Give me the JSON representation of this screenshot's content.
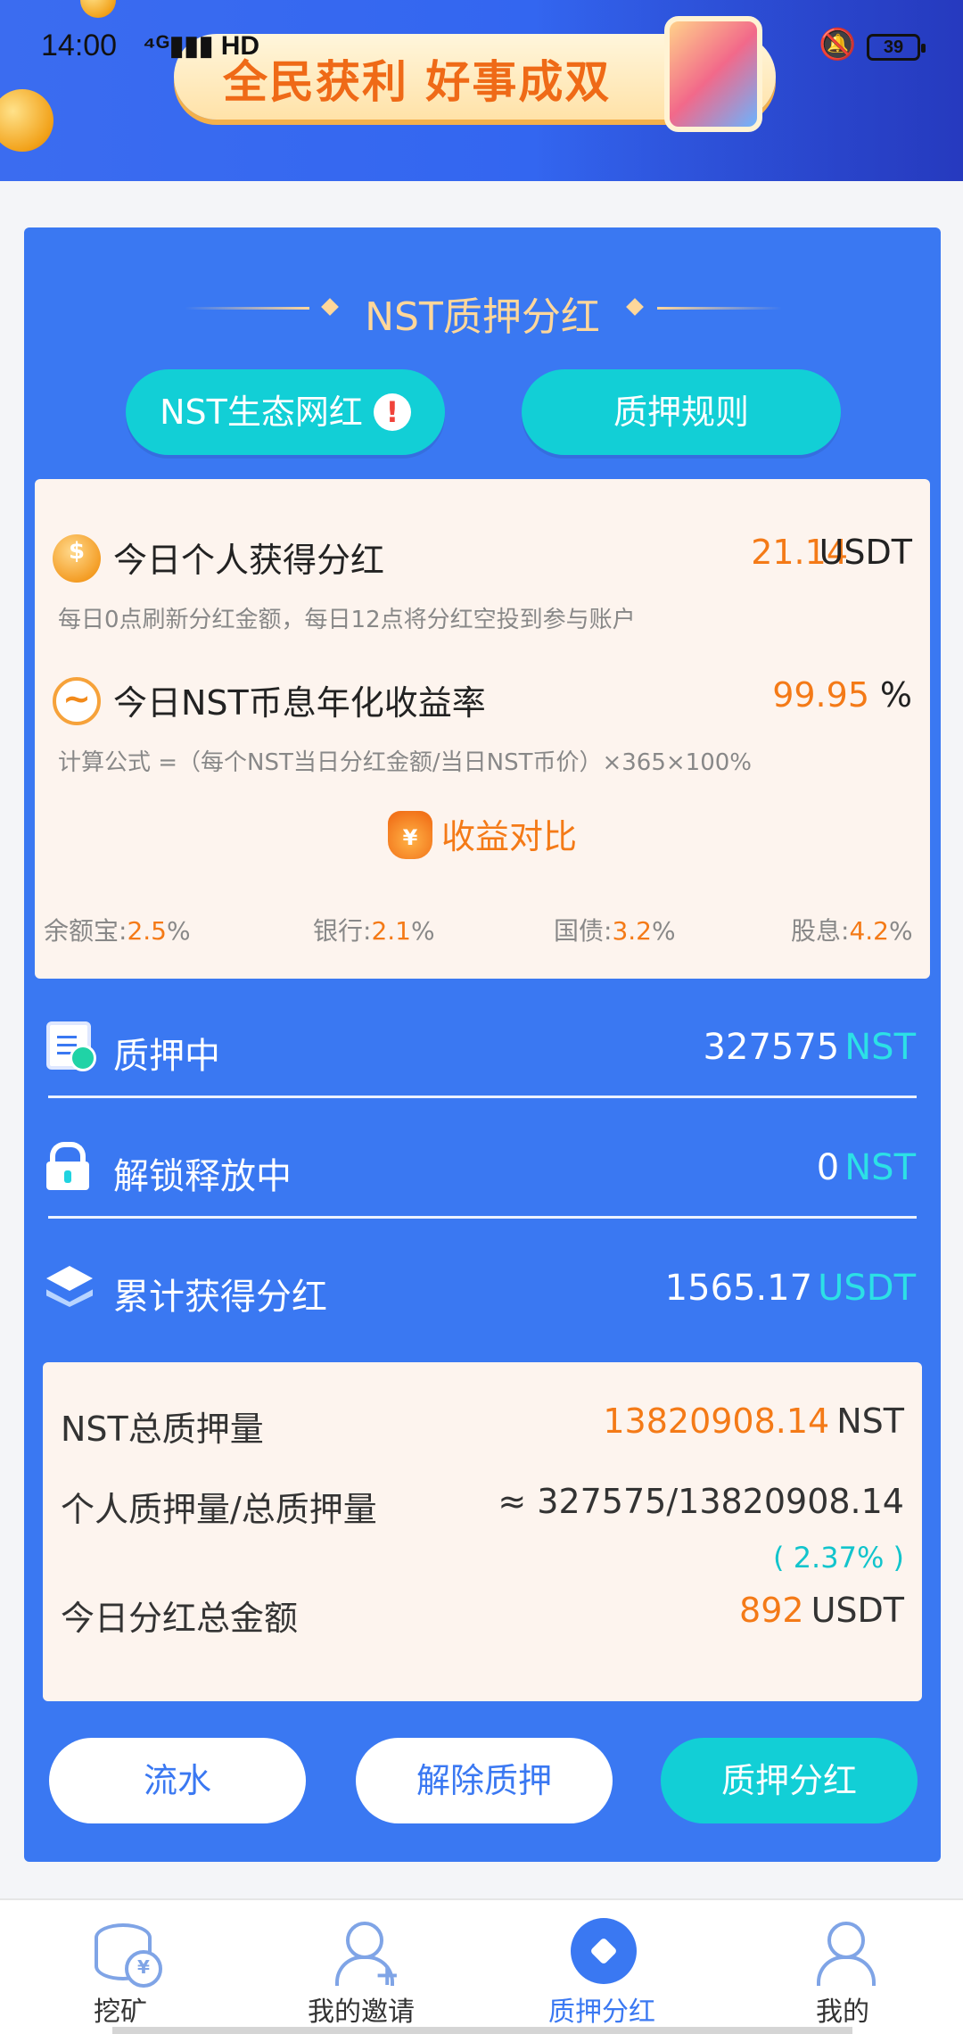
{
  "status_bar": {
    "time": "14:00",
    "network": "⁴ᴳ▮▮▮ HD",
    "battery": "39"
  },
  "banner": {
    "slogan": "全民获利 好事成双"
  },
  "card": {
    "title": "NST质押分红",
    "btn_influencer": "NST生态网红",
    "btn_influencer_badge": "!",
    "btn_rules": "质押规则"
  },
  "info_panel": {
    "personal_dividend_label": "今日个人获得分红",
    "personal_dividend_value": "21.14",
    "personal_dividend_unit": "USDT",
    "personal_dividend_note": "每日0点刷新分红金额，每日12点将分红空投到参与账户",
    "apy_label": "今日NST币息年化收益率",
    "apy_value": "99.95",
    "apy_unit": "%",
    "apy_note": "计算公式 =（每个NST当日分红金额/当日NST币价）×365×100%",
    "compare_label": "收益对比",
    "compare_icon": "¥",
    "rates": [
      {
        "name": "余额宝:",
        "value": "2.5",
        "unit": "%"
      },
      {
        "name": "银行:",
        "value": "2.1",
        "unit": "%"
      },
      {
        "name": "国债:",
        "value": "3.2",
        "unit": "%"
      },
      {
        "name": "股息:",
        "value": "4.2",
        "unit": "%"
      }
    ]
  },
  "stake_rows": [
    {
      "label": "质押中",
      "value": "327575",
      "unit": "NST"
    },
    {
      "label": "解锁释放中",
      "value": "0",
      "unit": "NST"
    },
    {
      "label": "累计获得分红",
      "value": "1565.17",
      "unit": "USDT"
    }
  ],
  "summary": {
    "total_label": "NST总质押量",
    "total_value": "13820908.14",
    "total_unit": "NST",
    "ratio_label": "个人质押量/总质押量",
    "ratio_value": "≈ 327575/13820908.14",
    "ratio_pct": "( 2.37% )",
    "today_total_label": "今日分红总金额",
    "today_total_value": "892",
    "today_total_unit": "USDT"
  },
  "actions": {
    "flow": "流水",
    "unstake": "解除质押",
    "stake_dividend": "质押分红"
  },
  "tabbar": [
    {
      "label": "挖矿",
      "icon": "coin-stack-icon"
    },
    {
      "label": "我的邀请",
      "icon": "user-add-icon"
    },
    {
      "label": "质押分红",
      "icon": "diamond-icon"
    },
    {
      "label": "我的",
      "icon": "user-icon"
    }
  ],
  "colors": {
    "primary_blue": "#3a78f2",
    "cyan": "#12cfd6",
    "orange": "#f47a17",
    "gold_title": "#ffd79a",
    "panel_bg": "#fdf4ee"
  }
}
